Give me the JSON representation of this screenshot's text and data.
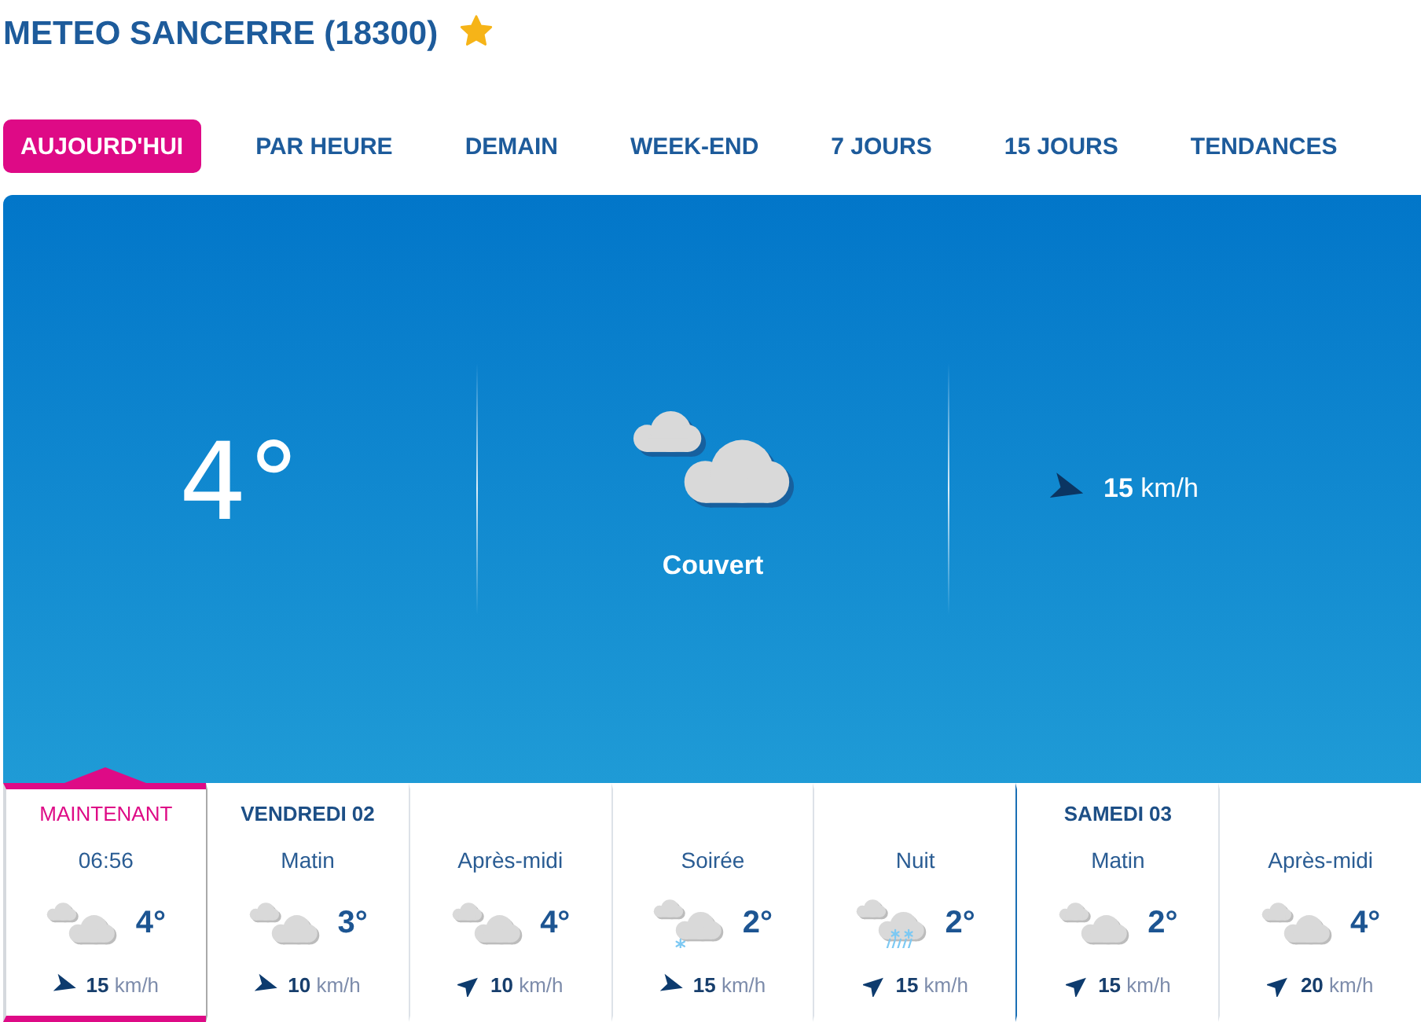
{
  "header": {
    "title": "METEO SANCERRE (18300)",
    "favorite": true
  },
  "tabs": [
    {
      "label": "AUJOURD'HUI",
      "selected": true
    },
    {
      "label": "PAR HEURE",
      "selected": false
    },
    {
      "label": "DEMAIN",
      "selected": false
    },
    {
      "label": "WEEK-END",
      "selected": false
    },
    {
      "label": "7 JOURS",
      "selected": false
    },
    {
      "label": "15 JOURS",
      "selected": false
    },
    {
      "label": "TENDANCES",
      "selected": false
    }
  ],
  "current": {
    "temperature": "4°",
    "kind": "overcast",
    "condition": "Couvert",
    "wind": {
      "kind": "east",
      "text": "**15** km/h"
    }
  },
  "forecast": [
    {
      "heading": "MAINTENANT",
      "label": "06:56",
      "kind": "overcast",
      "temperature": "4°",
      "wind": {
        "kind": "east",
        "text": "**15** km/h"
      },
      "selected": true
    },
    {
      "heading": "VENDREDI 02",
      "label": "Matin",
      "kind": "overcast",
      "temperature": "3°",
      "wind": {
        "kind": "east",
        "text": "**10** km/h"
      },
      "selected": false
    },
    {
      "label": "Après-midi",
      "kind": "overcast",
      "temperature": "4°",
      "wind": {
        "kind": "northeast",
        "text": "**10** km/h"
      },
      "selected": false
    },
    {
      "label": "Soirée",
      "kind": "snow",
      "temperature": "2°",
      "wind": {
        "kind": "east",
        "text": "**15** km/h"
      },
      "selected": false
    },
    {
      "label": "Nuit",
      "kind": "sleet",
      "temperature": "2°",
      "wind": {
        "kind": "northeast",
        "text": "**15** km/h"
      },
      "selected": false
    },
    {
      "heading": "SAMEDI 03",
      "label": "Matin",
      "kind": "overcast",
      "temperature": "2°",
      "wind": {
        "kind": "northeast",
        "text": "**15** km/h"
      },
      "selected": false
    },
    {
      "label": "Après-midi",
      "kind": "overcast",
      "temperature": "4°",
      "wind": {
        "kind": "northeast",
        "text": "**20** km/h"
      },
      "selected": false
    }
  ]
}
